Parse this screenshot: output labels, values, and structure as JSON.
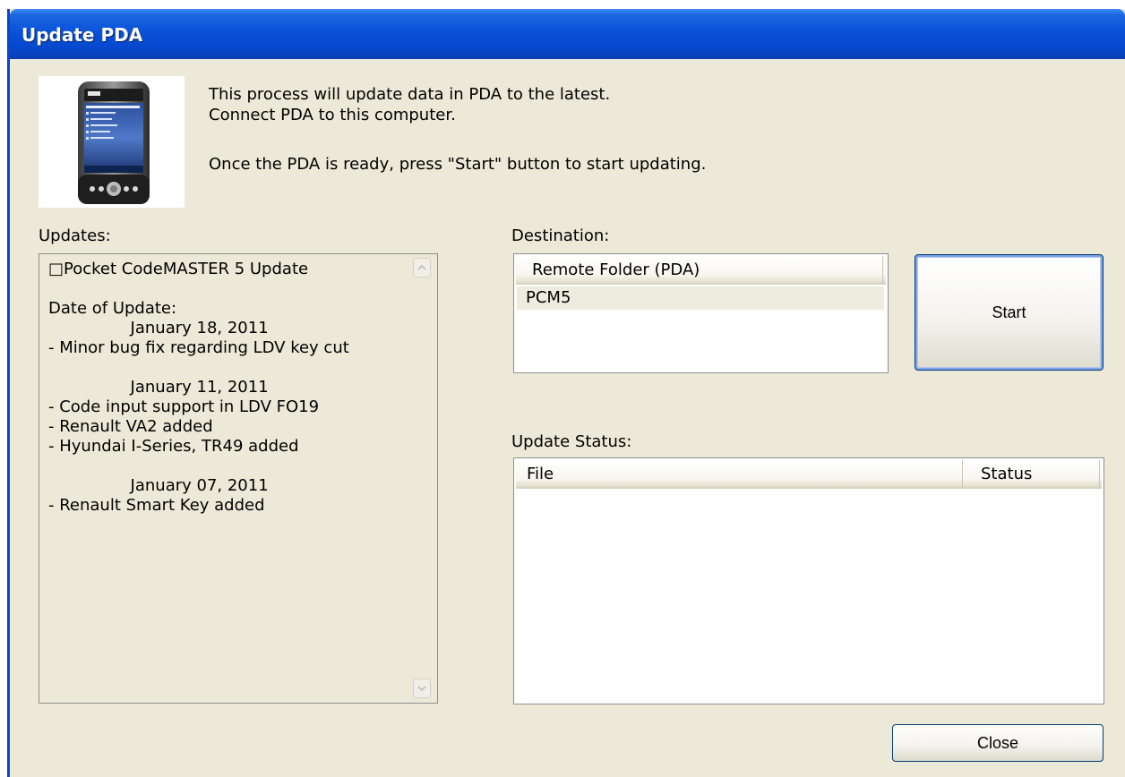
{
  "window": {
    "title": "Update PDA"
  },
  "intro": {
    "line1": "This process will update data in PDA to the latest.",
    "line2": "Connect PDA to this computer.",
    "line3": "Once the PDA is ready, press \"Start\" button to start updating."
  },
  "updates": {
    "label": "Updates:",
    "text": "□Pocket CodeMASTER 5 Update\n\nDate of Update:\n                January 18, 2011\n- Minor bug fix regarding LDV key cut\n\n                January 11, 2011\n- Code input support in LDV FO19\n- Renault VA2 added\n- Hyundai I-Series, TR49 added\n\n                January 07, 2011\n- Renault Smart Key added"
  },
  "destination": {
    "label": "Destination:",
    "column": "Remote Folder (PDA)",
    "rows": [
      "PCM5"
    ]
  },
  "status": {
    "label": "Update Status:",
    "columns": [
      "File",
      "Status"
    ]
  },
  "buttons": {
    "start": "Start",
    "close": "Close"
  },
  "icons": {
    "device_image": "pda-device-icon",
    "scroll_up": "scroll-up-arrow-icon",
    "scroll_down": "scroll-down-arrow-icon"
  }
}
